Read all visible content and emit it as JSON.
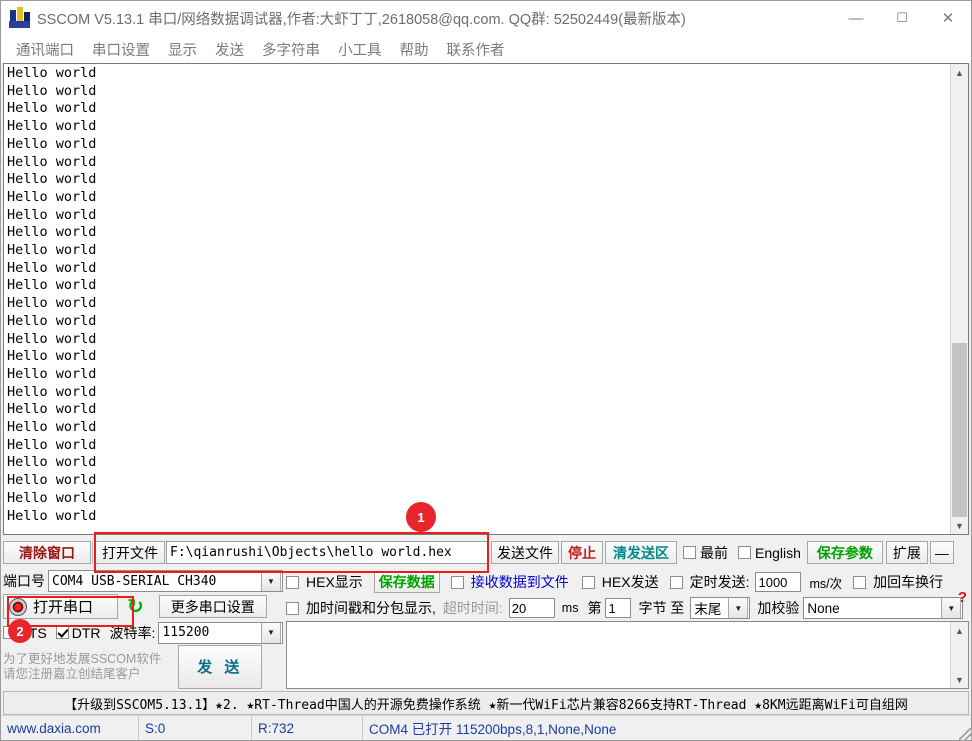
{
  "window": {
    "title": "SSCOM V5.13.1 串口/网络数据调试器,作者:大虾丁丁,2618058@qq.com. QQ群: 52502449(最新版本)",
    "minimize": "—",
    "maximize": "☐",
    "close": "✕",
    "app_icon": "sscom-logo-icon"
  },
  "menubar": {
    "items": [
      {
        "label": "通讯端口"
      },
      {
        "label": "串口设置"
      },
      {
        "label": "显示"
      },
      {
        "label": "发送"
      },
      {
        "label": "多字符串"
      },
      {
        "label": "小工具"
      },
      {
        "label": "帮助"
      },
      {
        "label": "联系作者"
      }
    ]
  },
  "receive": {
    "lines": [
      "Hello world",
      "Hello world",
      "Hello world",
      "Hello world",
      "Hello world",
      "Hello world",
      "Hello world",
      "Hello world",
      "Hello world",
      "Hello world",
      "Hello world",
      "Hello world",
      "Hello world",
      "Hello world",
      "Hello world",
      "Hello world",
      "Hello world",
      "Hello world",
      "Hello world",
      "Hello world",
      "Hello world",
      "Hello world",
      "Hello world",
      "Hello world",
      "Hello world",
      "Hello world"
    ],
    "scroll_up": "▲",
    "scroll_down": "▼"
  },
  "badges": {
    "one": "1",
    "two": "2"
  },
  "toolbar": {
    "clear_window": "清除窗口",
    "open_file": "打开文件",
    "file_path": "F:\\qianrushi\\Objects\\hello world.hex",
    "send_file": "发送文件",
    "stop": "停止",
    "clear_send": "清发送区",
    "topmost_label": "最前",
    "topmost_checked": false,
    "english_label": "English",
    "english_checked": false,
    "save_params": "保存参数",
    "extend": "扩展",
    "collapse": "—"
  },
  "port_panel": {
    "port_label": "端口号",
    "port_value": "COM4  USB-SERIAL CH340",
    "open_port_button": "打开串口",
    "port_icon": "port-status-icon",
    "refresh_icon": "refresh-icon",
    "more_settings": "更多串口设置",
    "rts_label": "RTS",
    "rts_checked": false,
    "dtr_label": "DTR",
    "dtr_checked": true,
    "baud_label": "波特率:",
    "baud_value": "115200",
    "promo_line1": "为了更好地发展SSCOM软件",
    "promo_line2": "请您注册嘉立创结尾客户",
    "send_button": "发 送"
  },
  "recv_options": {
    "hex_display_label": "HEX显示",
    "hex_display_checked": false,
    "save_data_button": "保存数据",
    "save_to_file_label": "接收数据到文件",
    "save_to_file_checked": false,
    "timestamp_label": "加时间戳和分包显示,",
    "timestamp_checked": false,
    "timeout_label": "超时时间:",
    "timeout_value": "20",
    "timeout_unit": "ms"
  },
  "send_options": {
    "hex_send_label": "HEX发送",
    "hex_send_checked": false,
    "timed_send_label": "定时发送:",
    "timed_send_checked": false,
    "interval_value": "1000",
    "interval_unit": "ms/次",
    "crlf_label": "加回车换行",
    "crlf_checked": false,
    "help_icon": "help-question-icon",
    "byte_prefix": "第",
    "byte_start": "1",
    "byte_mid": "字节 至",
    "byte_end": "末尾",
    "checksum_label": "加校验",
    "checksum_value": "None"
  },
  "ticker": {
    "text": "【升级到SSCOM5.13.1】★2.  ★RT-Thread中国人的开源免费操作系统 ★新一代WiFi芯片兼容8266支持RT-Thread ★8KM远距离WiFi可自组网"
  },
  "statusbar": {
    "website": "www.daxia.com",
    "sent": "S:0",
    "received": "R:732",
    "connection": "COM4 已打开  115200bps,8,1,None,None",
    "resize_grip": "resize-grip-icon"
  },
  "colors": {
    "accent_red": "#9e1313",
    "accent_green": "#00a000",
    "accent_teal": "#008a8a",
    "accent_blue": "#0000cc",
    "badge_red": "#e8252a",
    "highlight_red": "#f01a1a"
  }
}
